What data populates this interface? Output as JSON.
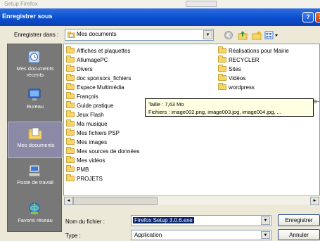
{
  "background": {
    "title_text": "Setup Firefox"
  },
  "dialog": {
    "title": "Enregistrer sous",
    "help_button": "?",
    "close_button": "x"
  },
  "save_in": {
    "label": "Enregistrer dans :",
    "value": "Mes documents"
  },
  "toolbar": {
    "icons": [
      "back-icon",
      "up-folder-icon",
      "new-folder-icon",
      "views-menu-icon"
    ]
  },
  "places": [
    {
      "label": "Mes documents récents",
      "icon": "recent-documents-icon"
    },
    {
      "label": "Bureau",
      "icon": "desktop-icon"
    },
    {
      "label": "Mes documents",
      "icon": "my-documents-icon",
      "selected": true
    },
    {
      "label": "Poste de travail",
      "icon": "my-computer-icon"
    },
    {
      "label": "Favoris réseau",
      "icon": "network-places-icon"
    }
  ],
  "files_col1": [
    "Affiches et plaquettes",
    "AllumagePC",
    "Divers",
    "doc sponsors_fichiers",
    "Espace Multimédia",
    "François",
    "Guide pratique",
    "Jeux Flash",
    "Ma musique",
    "Mes fichiers PSP",
    "Mes images",
    "Mes sources de données",
    "Mes vidéos",
    "PMB",
    "PROJETS"
  ],
  "files_col2": [
    "Réalisations pour Mairie",
    "RECYCLER",
    "Sites",
    "Vidéos",
    "wordpress"
  ],
  "tooltip": {
    "line1": "Taille : 7,63 Mo",
    "line2": "Fichiers : image002.png, image003.jpg, image004.jpg, ..."
  },
  "tooltip_overflow_text": "9~",
  "filename": {
    "label": "Nom du fichier :",
    "value": "Firefox Setup 3.0.6.exe"
  },
  "filetype": {
    "label": "Type :",
    "value": "Application"
  },
  "buttons": {
    "save": "Enregistrer",
    "cancel": "Annuler"
  }
}
